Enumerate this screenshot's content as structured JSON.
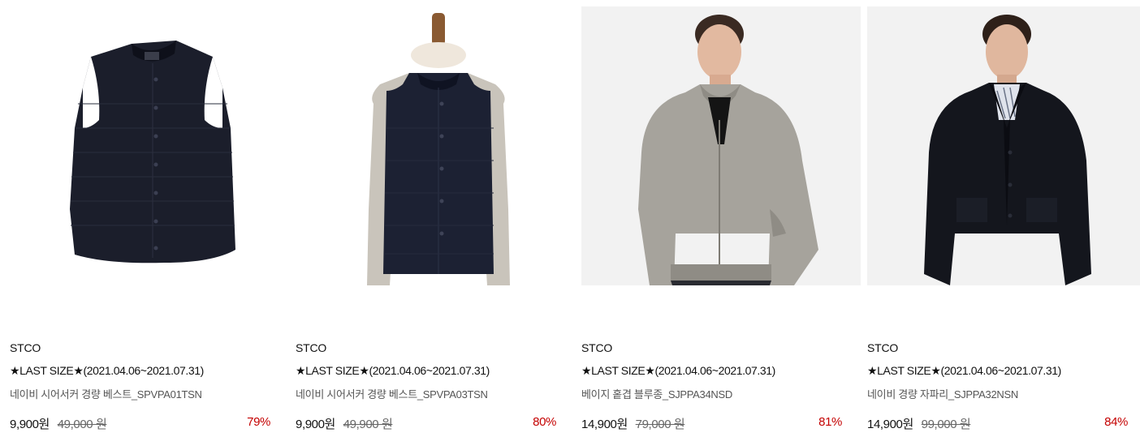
{
  "products": [
    {
      "brand": "STCO",
      "event": "★LAST SIZE★(2021.04.06~2021.07.31)",
      "name": "네이비 시어서커 경량 베스트_SPVPA01TSN",
      "sale_price": "9,900원",
      "original_price": "49,000 원",
      "discount": "79%",
      "image": "navy-vest-flatlay"
    },
    {
      "brand": "STCO",
      "event": "★LAST SIZE★(2021.04.06~2021.07.31)",
      "name": "네이비 시어서커 경량 베스트_SPVPA03TSN",
      "sale_price": "9,900원",
      "original_price": "49,900 원",
      "discount": "80%",
      "image": "navy-vest-mannequin"
    },
    {
      "brand": "STCO",
      "event": "★LAST SIZE★(2021.04.06~2021.07.31)",
      "name": "베이지 홑겹 블루종_SJPPA34NSD",
      "sale_price": "14,900원",
      "original_price": "79,000 원",
      "discount": "81%",
      "image": "beige-blouson-model"
    },
    {
      "brand": "STCO",
      "event": "★LAST SIZE★(2021.04.06~2021.07.31)",
      "name": "네이비 경량 자파리_SJPPA32NSN",
      "sale_price": "14,900원",
      "original_price": "99,000 원",
      "discount": "84%",
      "image": "navy-jacket-model"
    }
  ],
  "colors": {
    "discount": "#c40000",
    "price": "#111111",
    "original_price": "#666666"
  }
}
